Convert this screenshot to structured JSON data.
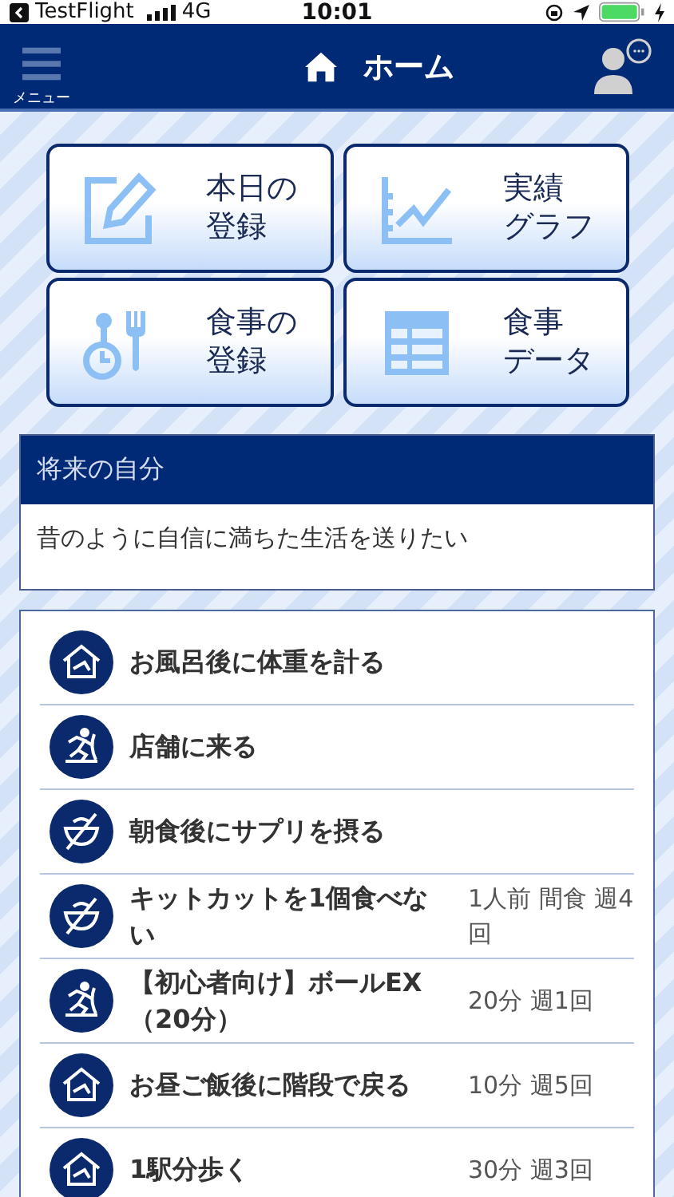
{
  "status_bar": {
    "back_app": "TestFlight",
    "network": "4G",
    "time": "10:01"
  },
  "nav": {
    "menu_label": "メニュー",
    "title": "ホーム"
  },
  "tiles": [
    {
      "kind": "edit",
      "label_lines": [
        "本日の",
        "登録"
      ]
    },
    {
      "kind": "graph",
      "label_lines": [
        "実績",
        "グラフ"
      ]
    },
    {
      "kind": "meal",
      "label_lines": [
        "食事の",
        "登録"
      ]
    },
    {
      "kind": "table",
      "label_lines": [
        "食事",
        "データ"
      ]
    }
  ],
  "goal": {
    "heading": "将来の自分",
    "text": "昔のように自信に満ちた生活を送りたい"
  },
  "tasks": [
    {
      "kind": "home",
      "title": "お風呂後に体重を計る"
    },
    {
      "kind": "exercise",
      "title": "店舗に来る"
    },
    {
      "kind": "diet",
      "title": "朝食後にサプリを摂る"
    },
    {
      "kind": "diet",
      "title": "キットカットを1個食べない",
      "detail": "1人前 間食 週4回"
    },
    {
      "kind": "exercise",
      "title": "【初心者向け】ボールEX（20分）",
      "detail": "20分 週1回"
    },
    {
      "kind": "home",
      "title": "お昼ご飯後に階段で戻る",
      "detail": "10分 週5回"
    },
    {
      "kind": "home",
      "title": "1駅分歩く",
      "detail": "30分 週3回"
    }
  ]
}
